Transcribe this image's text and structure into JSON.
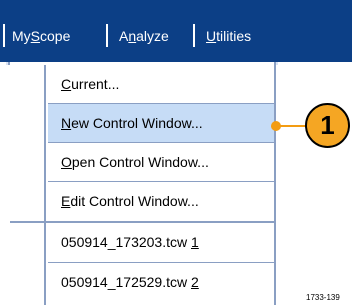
{
  "menubar": {
    "items": [
      {
        "label": "MyScope",
        "mnemonic": "S"
      },
      {
        "label": "Analyze",
        "mnemonic": "n"
      },
      {
        "label": "Utilities",
        "mnemonic": "U"
      }
    ]
  },
  "menu": {
    "items": [
      {
        "label": "Current...",
        "mnemonic": "C",
        "highlighted": false
      },
      {
        "label": "New Control Window...",
        "mnemonic": "N",
        "highlighted": true
      },
      {
        "label": "Open Control Window...",
        "mnemonic": "O",
        "highlighted": false
      },
      {
        "label": "Edit Control Window...",
        "mnemonic": "E",
        "highlighted": false
      },
      {
        "label": "050914_173203.tcw 1",
        "mnemonic": "1",
        "highlighted": false
      },
      {
        "label": "050914_172529.tcw 2",
        "mnemonic": "2",
        "highlighted": false
      }
    ]
  },
  "callout": {
    "number": "1"
  },
  "figure_id": "1733-139",
  "colors": {
    "menubar_bg": "#0c3f86",
    "highlight_bg": "#c6dcf6",
    "callout_fill": "#f5a623",
    "callout_line": "#f39c12",
    "border": "#8a9fc3"
  }
}
